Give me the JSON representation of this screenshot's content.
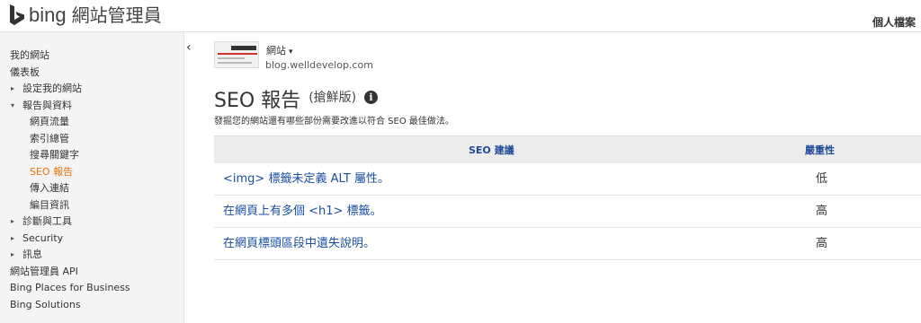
{
  "header": {
    "brand": "bing",
    "product": "網站管理員",
    "profile_label": "個人檔案"
  },
  "sidebar": {
    "collapse_glyph": "‹",
    "items": [
      {
        "label": "我的網站",
        "level": 0
      },
      {
        "label": "儀表板",
        "level": 0
      },
      {
        "label": "設定我的網站",
        "level": 0,
        "expander": "▸"
      },
      {
        "label": "報告與資料",
        "level": 0,
        "expander": "▾"
      },
      {
        "label": "網頁流量",
        "level": 1
      },
      {
        "label": "索引總管",
        "level": 1
      },
      {
        "label": "搜尋關鍵字",
        "level": 1
      },
      {
        "label": "SEO 報告",
        "level": 1,
        "active": true
      },
      {
        "label": "傳入連結",
        "level": 1
      },
      {
        "label": "編目資訊",
        "level": 1
      },
      {
        "label": "診斷與工具",
        "level": 0,
        "expander": "▸"
      },
      {
        "label": "Security",
        "level": 0,
        "expander": "▸"
      },
      {
        "label": "訊息",
        "level": 0,
        "expander": "▸"
      },
      {
        "label": "網站管理員 API",
        "level": 0
      },
      {
        "label": "Bing Places for Business",
        "level": 0
      },
      {
        "label": "Bing Solutions",
        "level": 0
      }
    ]
  },
  "site": {
    "label": "網站",
    "caret": "▾",
    "url": "blog.welldevelop.com"
  },
  "main": {
    "title": "SEO 報告",
    "preview_tag": "(搶鮮版)",
    "info_glyph": "i",
    "description": "發掘您的網站還有哪些部份需要改進以符合 SEO 最佳做法。"
  },
  "table": {
    "col_recommendation": "SEO 建議",
    "col_severity": "嚴重性",
    "rows": [
      {
        "recommendation": "<img> 標籤未定義 ALT 屬性。",
        "severity": "低"
      },
      {
        "recommendation": "在網頁上有多個 <h1> 標籤。",
        "severity": "高"
      },
      {
        "recommendation": "在網頁標頭區段中遺失說明。",
        "severity": "高"
      }
    ]
  },
  "colors": {
    "accent": "#e8730c",
    "link": "#1a4fa0",
    "header_text": "#1e4a9a"
  }
}
